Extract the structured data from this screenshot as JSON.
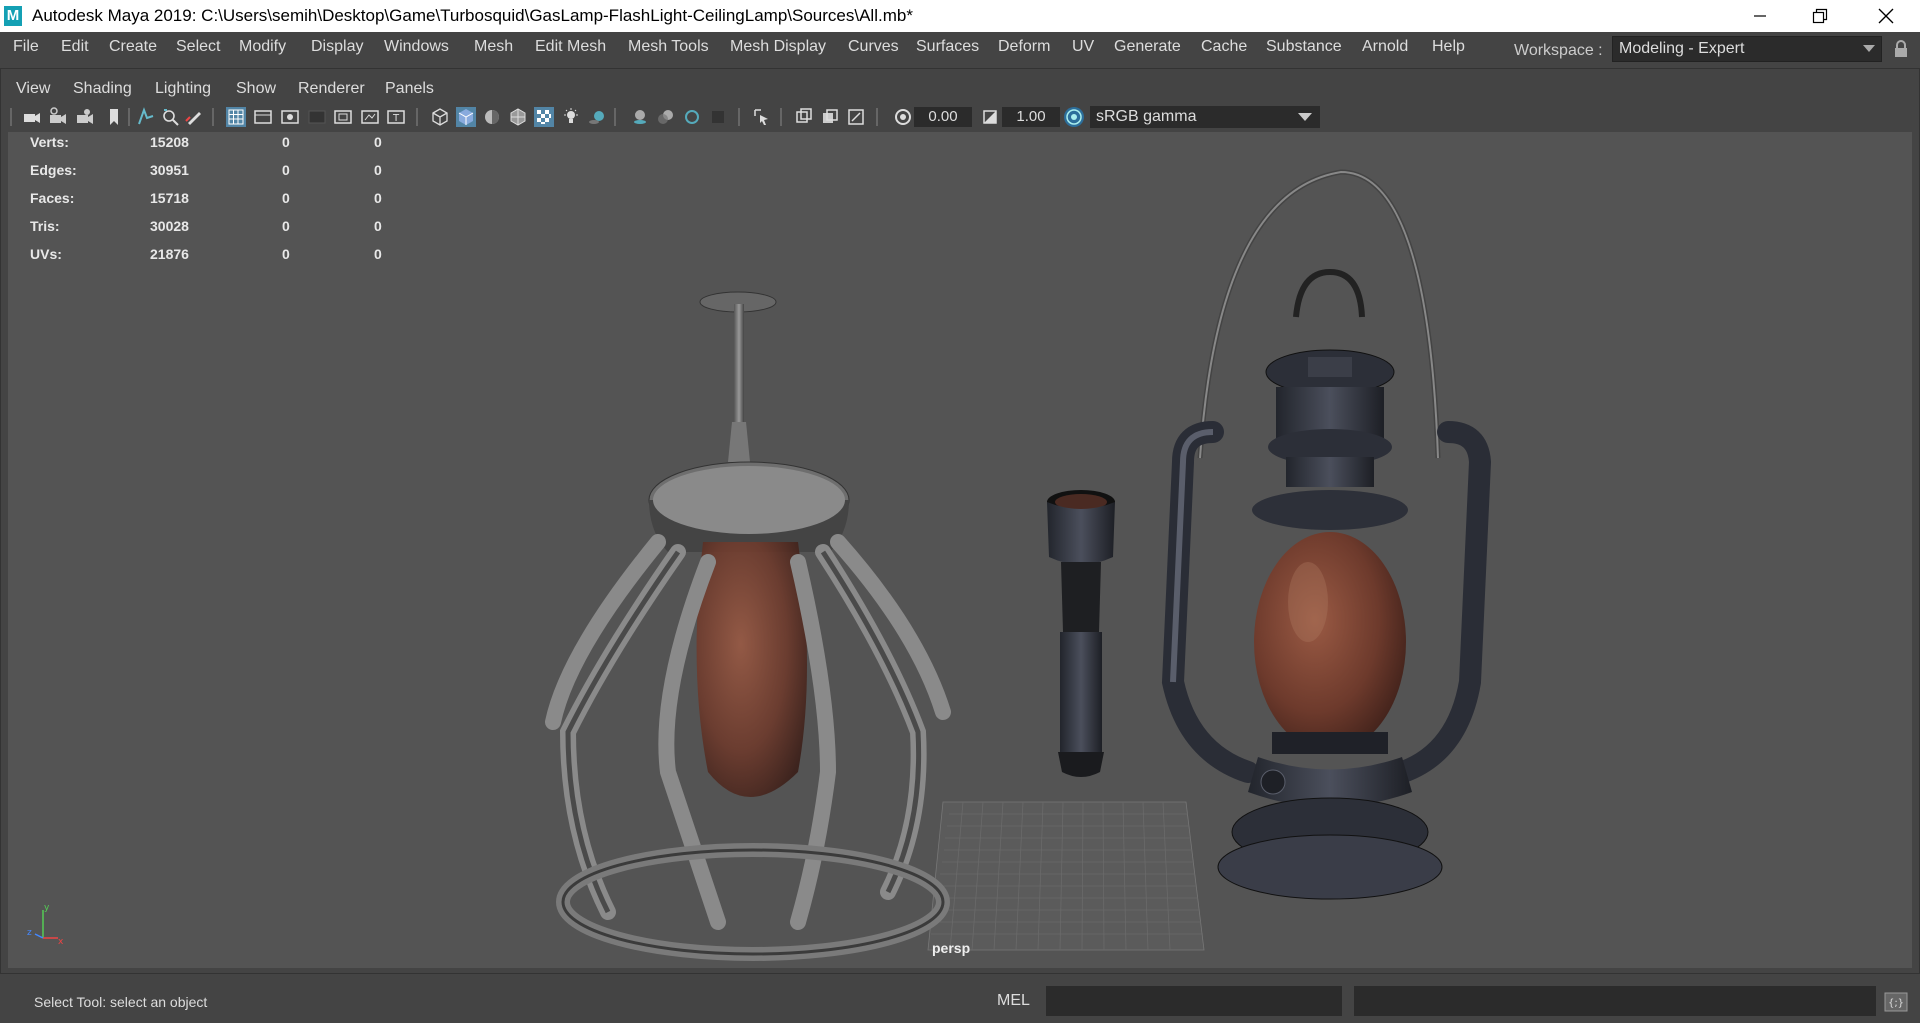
{
  "window": {
    "app_logo": "M",
    "title": "Autodesk Maya 2019: C:\\Users\\semih\\Desktop\\Game\\Turbosquid\\GasLamp-FlashLight-CeilingLamp\\Sources\\All.mb*"
  },
  "menubar": {
    "items": [
      "File",
      "Edit",
      "Create",
      "Select",
      "Modify",
      "Display",
      "Windows",
      "Mesh",
      "Edit Mesh",
      "Mesh Tools",
      "Mesh Display",
      "Curves",
      "Surfaces",
      "Deform",
      "UV",
      "Generate",
      "Cache",
      "Substance",
      "Arnold",
      "Help"
    ],
    "workspace_label": "Workspace :",
    "workspace_value": "Modeling - Expert"
  },
  "panel_menu": {
    "items": [
      "View",
      "Shading",
      "Lighting",
      "Show",
      "Renderer",
      "Panels"
    ]
  },
  "toolbar": {
    "exposure": "0.00",
    "gamma": "1.00",
    "colorspace": "sRGB gamma"
  },
  "hud": {
    "rows": [
      {
        "label": "Verts:",
        "v1": "15208",
        "v2": "0",
        "v3": "0"
      },
      {
        "label": "Edges:",
        "v1": "30951",
        "v2": "0",
        "v3": "0"
      },
      {
        "label": "Faces:",
        "v1": "15718",
        "v2": "0",
        "v3": "0"
      },
      {
        "label": "Tris:",
        "v1": "30028",
        "v2": "0",
        "v3": "0"
      },
      {
        "label": "UVs:",
        "v1": "21876",
        "v2": "0",
        "v3": "0"
      }
    ]
  },
  "viewport": {
    "camera": "persp",
    "axis_labels": {
      "x": "x",
      "y": "y",
      "z": "z"
    }
  },
  "statusbar": {
    "help_text": "Select Tool: select an object",
    "mel_label": "MEL"
  }
}
